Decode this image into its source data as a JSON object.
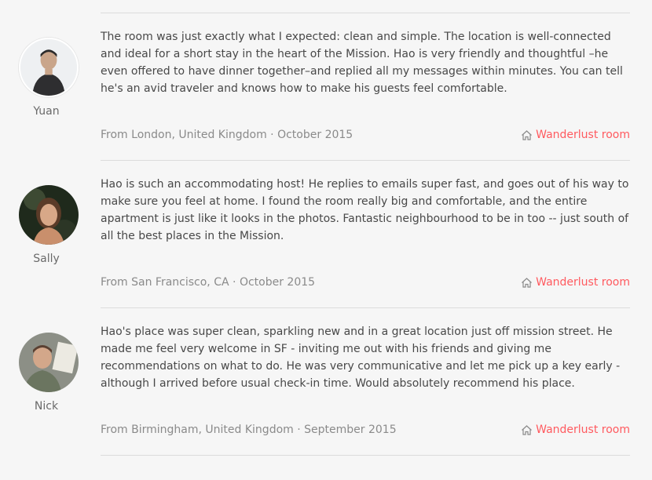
{
  "reviews": [
    {
      "name": "Yuan",
      "text": "The room was just exactly what I expected: clean and simple. The location is well-connected and ideal for a short stay in the heart of the Mission. Hao is very friendly and thoughtful –he even offered to have dinner together–and replied all my messages within minutes. You can tell he's an avid traveler and knows how to make his guests feel comfortable.",
      "location": "From London, United Kingdom",
      "date": "October 2015",
      "listing": "Wanderlust room"
    },
    {
      "name": "Sally",
      "text": "Hao is such an accommodating host! He replies to emails super fast, and goes out of his way to make sure you feel at home. I found the room really big and comfortable, and the entire apartment is just like it looks in the photos. Fantastic neighbourhood to be in too -- just south of all the best places in the Mission.",
      "location": "From San Francisco, CA",
      "date": "October 2015",
      "listing": "Wanderlust room"
    },
    {
      "name": "Nick",
      "text": "Hao's place was super clean, sparkling new and in a great location just off mission street. He made me feel very welcome in SF - inviting me out with his friends and giving me recommendations on what to do. He was very communicative and let me pick up a key early - although I arrived before usual check-in time. Would absolutely recommend his place.",
      "location": "From Birmingham, United Kingdom",
      "date": "September 2015",
      "listing": "Wanderlust room"
    }
  ],
  "separator": " · ",
  "colors": {
    "accent": "#ff5a5f",
    "text": "#484848",
    "muted": "#8a8a8a",
    "divider": "#dcdcdc"
  }
}
